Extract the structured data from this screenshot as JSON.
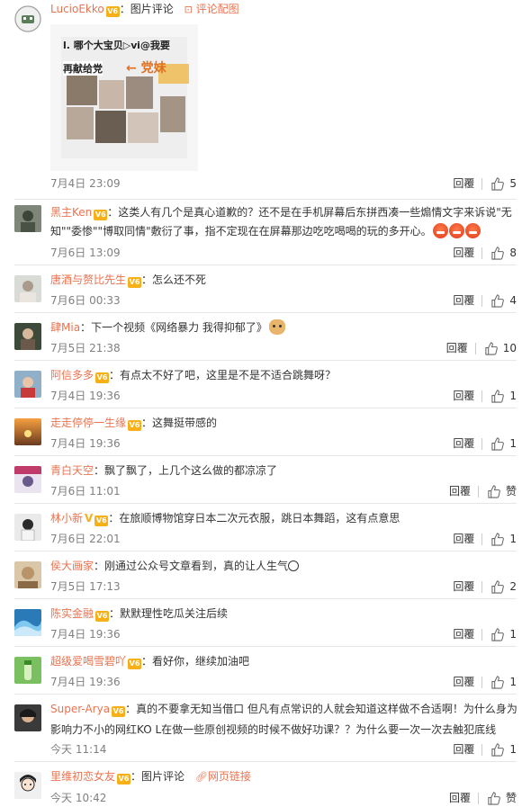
{
  "ui": {
    "reply_label": "回覆",
    "accent": "#eb7350",
    "like_icon": "thumbs-up-icon"
  },
  "comments": [
    {
      "user": "LucioEkko",
      "separator": "：",
      "text": "图片评论",
      "link_icon": "image-icon",
      "link_text": "评论配图",
      "time": "7月4日 23:09",
      "likes": "5",
      "image_caption_lines": [
        "l. 哪个大宝贝▷ⅵ@我要",
        "再献给党",
        "← 党妹"
      ]
    },
    {
      "user": "黑主Ken",
      "separator": "：",
      "text_line1": "这类人有几个是真心道歉的？还不是在手机屏幕后东拼西凑一些煽情文字来诉说\"无",
      "text_line2": "知\"\"委惨\"\"博取同情\"敷衍了事，指不定现在在屏幕那边吃吃喝喝的玩的多开心。",
      "emoji": "angry-emoji",
      "time": "7月6日 13:09",
      "likes": "8"
    },
    {
      "user": "唐酒与赘比先生",
      "separator": "：",
      "text": "怎么还不死",
      "time": "7月6日 00:33",
      "likes": "4"
    },
    {
      "user": "肆Mia",
      "separator": "：",
      "text": "下一个视频《网络暴力 我得抑郁了》",
      "emoji": "cat-emoji",
      "time": "7月5日 21:38",
      "likes": "10"
    },
    {
      "user": "阿信多多",
      "separator": "：",
      "text": "有点太不好了吧，这里是不是不适合跳舞呀？",
      "time": "7月4日 19:36",
      "likes": "1"
    },
    {
      "user": "走走停停一生缘",
      "separator": "：",
      "text": "这舞挺带感的",
      "time": "7月4日 19:36",
      "likes": "1"
    },
    {
      "user": "青白天空",
      "separator": "：",
      "text": "飘了飘了，上几个这么做的都凉凉了",
      "time": "7月6日 11:01",
      "likes": "赞"
    },
    {
      "user": "林小新",
      "vip_badge": "V",
      "separator": "：",
      "text": "在旅顺博物馆穿日本二次元衣服，跳日本舞蹈，这有点意思",
      "time": "7月6日 22:01",
      "likes": "1"
    },
    {
      "user": "侯大画家",
      "separator": "：",
      "text": "刚通过公众号文章看到，真的让人生气",
      "emoji": "smile-emoji",
      "time": "7月5日 17:13",
      "likes": "2"
    },
    {
      "user": "陈实金融",
      "separator": "：",
      "text": "默默理性吃瓜关注后续",
      "time": "7月4日 19:36",
      "likes": "1"
    },
    {
      "user": "超级爱喝雪碧吖",
      "separator": "：",
      "text": "看好你，继续加油吧",
      "time": "7月4日 19:36",
      "likes": "1"
    },
    {
      "user": "Super-Arya",
      "separator": "：",
      "text_line1": "真的不要拿无知当借口 但凡有点常识的人就会知道这样做不合适啊！为什么身为",
      "text_line2": "影响力不小的网红KO L在做一些原创视频的时候不做好功课？？为什么要一次一次去触犯底线",
      "time": "今天 11:14",
      "likes": "1"
    },
    {
      "user": "里维初恋女友",
      "separator": "：",
      "text": "图片评论",
      "link_icon": "link-icon",
      "link_text": "网页链接",
      "time": "今天 10:42",
      "likes": "赞"
    }
  ]
}
